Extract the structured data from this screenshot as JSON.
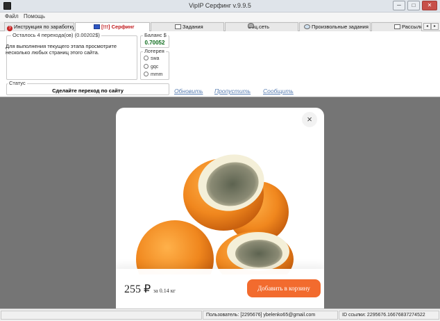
{
  "window": {
    "title": "VipIP Серфинг  v.9.9.5",
    "minimize": "─",
    "maximize": "□",
    "close": "✕"
  },
  "menu": [
    "Файл",
    "Помощь"
  ],
  "tabs": [
    {
      "label": "Инструкция по заработку",
      "icon": "question-icon",
      "active": false
    },
    {
      "label": "[!!!] Серфинг",
      "icon": "surf-icon",
      "active": true
    },
    {
      "label": "Задания",
      "icon": "tasks-icon",
      "active": false
    },
    {
      "label": "Соц.сеть",
      "icon": "social-icon",
      "active": false
    },
    {
      "label": "Произвольные задания",
      "icon": "globe-icon",
      "active": false
    },
    {
      "label": "Рассылки",
      "icon": "mail-icon",
      "active": false
    }
  ],
  "task": {
    "legend": "Осталось 4 перехода(ов) (0.00202$)",
    "description": "Для выполнения текущего этапа просмотрите несколько любых страниц этого сайта."
  },
  "balance": {
    "legend": "Баланс $",
    "value": "0.70052"
  },
  "lottery": {
    "legend": "Лотерея",
    "options": [
      "swa",
      "gqc",
      "mmm"
    ]
  },
  "status": {
    "legend": "Статус",
    "text": "Сделайте переход по сайту"
  },
  "links": {
    "refresh": "Обновить",
    "skip": "Пропустить",
    "report": "Сообщить"
  },
  "product": {
    "price": "255 ₽",
    "per": "за 0.14 кг",
    "button": "Добавить в корзину",
    "close": "×",
    "accent": "#f26b2e"
  },
  "statusbar": {
    "user": "Пользователь: [2295676] ybelenko65@gmail.com",
    "ref": "ID ссылки: 2295676.16676837274522"
  }
}
